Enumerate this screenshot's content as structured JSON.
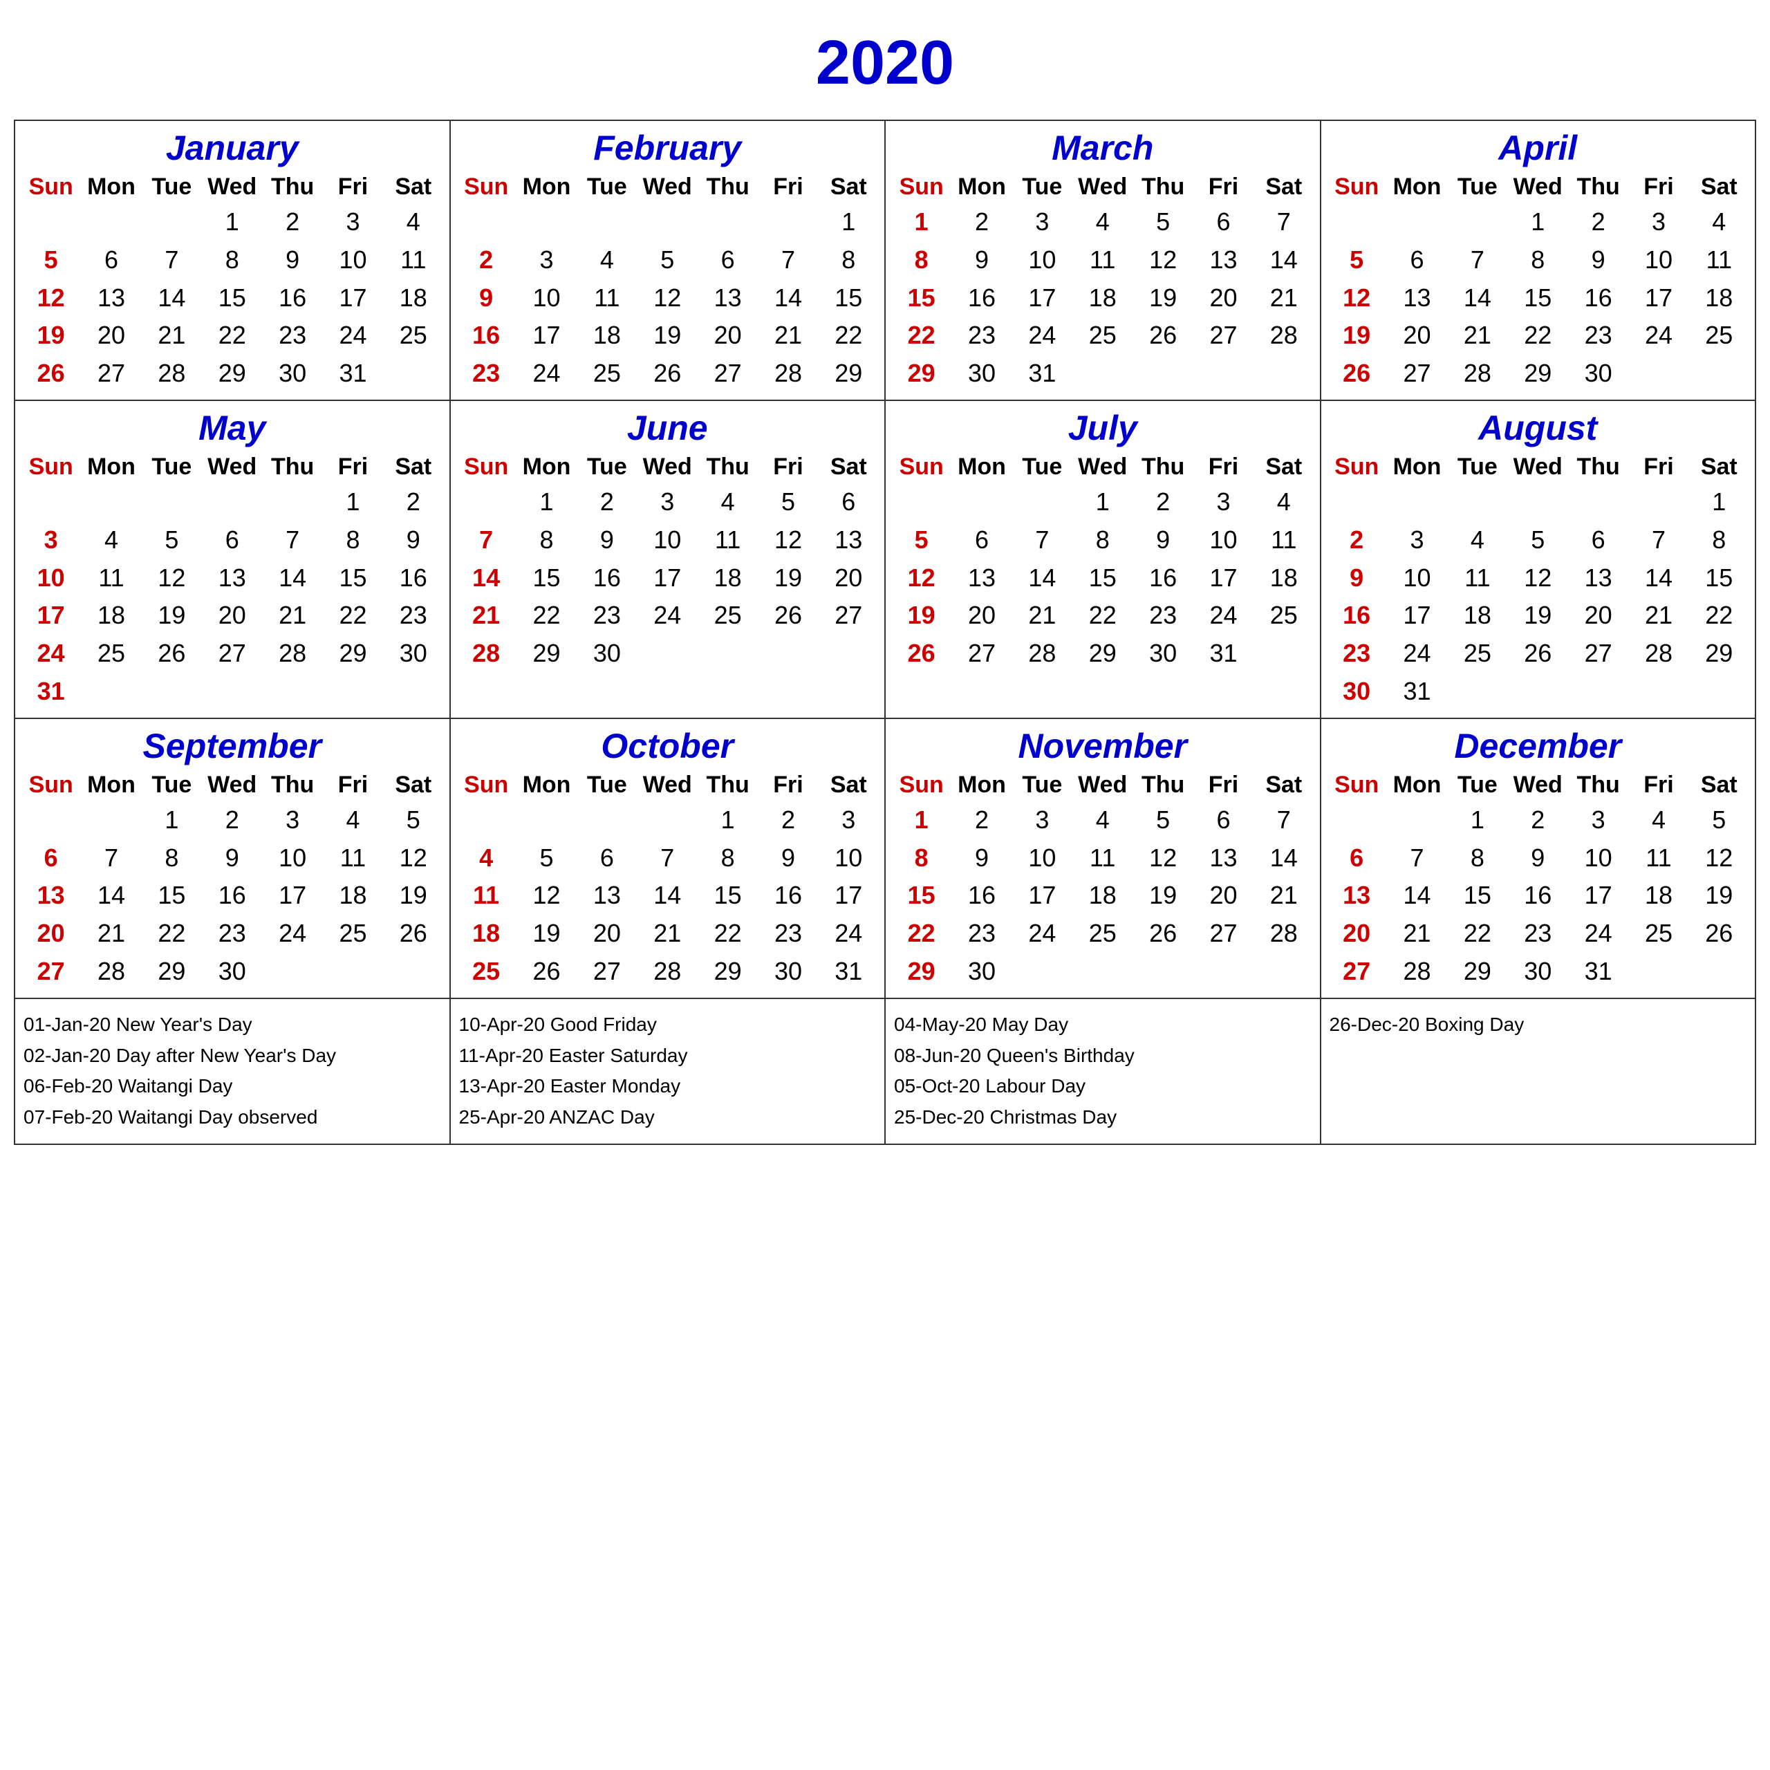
{
  "title": "2020",
  "months": [
    {
      "name": "January",
      "startDay": 3,
      "days": 31,
      "weeks": [
        [
          "",
          "",
          "",
          "1",
          "2",
          "3",
          "4"
        ],
        [
          "5",
          "6",
          "7",
          "8",
          "9",
          "10",
          "11"
        ],
        [
          "12",
          "13",
          "14",
          "15",
          "16",
          "17",
          "18"
        ],
        [
          "19",
          "20",
          "21",
          "22",
          "23",
          "24",
          "25"
        ],
        [
          "26",
          "27",
          "28",
          "29",
          "30",
          "31",
          ""
        ]
      ]
    },
    {
      "name": "February",
      "startDay": 6,
      "days": 29,
      "weeks": [
        [
          "",
          "",
          "",
          "",
          "",
          "",
          "1"
        ],
        [
          "2",
          "3",
          "4",
          "5",
          "6",
          "7",
          "8"
        ],
        [
          "9",
          "10",
          "11",
          "12",
          "13",
          "14",
          "15"
        ],
        [
          "16",
          "17",
          "18",
          "19",
          "20",
          "21",
          "22"
        ],
        [
          "23",
          "24",
          "25",
          "26",
          "27",
          "28",
          "29"
        ]
      ]
    },
    {
      "name": "March",
      "startDay": 0,
      "days": 31,
      "weeks": [
        [
          "1",
          "2",
          "3",
          "4",
          "5",
          "6",
          "7"
        ],
        [
          "8",
          "9",
          "10",
          "11",
          "12",
          "13",
          "14"
        ],
        [
          "15",
          "16",
          "17",
          "18",
          "19",
          "20",
          "21"
        ],
        [
          "22",
          "23",
          "24",
          "25",
          "26",
          "27",
          "28"
        ],
        [
          "29",
          "30",
          "31",
          "",
          "",
          "",
          ""
        ]
      ]
    },
    {
      "name": "April",
      "startDay": 3,
      "days": 30,
      "weeks": [
        [
          "",
          "",
          "",
          "1",
          "2",
          "3",
          "4"
        ],
        [
          "5",
          "6",
          "7",
          "8",
          "9",
          "10",
          "11"
        ],
        [
          "12",
          "13",
          "14",
          "15",
          "16",
          "17",
          "18"
        ],
        [
          "19",
          "20",
          "21",
          "22",
          "23",
          "24",
          "25"
        ],
        [
          "26",
          "27",
          "28",
          "29",
          "30",
          "",
          ""
        ]
      ]
    },
    {
      "name": "May",
      "startDay": 5,
      "days": 31,
      "weeks": [
        [
          "",
          "",
          "",
          "",
          "",
          "1",
          "2"
        ],
        [
          "3",
          "4",
          "5",
          "6",
          "7",
          "8",
          "9"
        ],
        [
          "10",
          "11",
          "12",
          "13",
          "14",
          "15",
          "16"
        ],
        [
          "17",
          "18",
          "19",
          "20",
          "21",
          "22",
          "23"
        ],
        [
          "24",
          "25",
          "26",
          "27",
          "28",
          "29",
          "30"
        ],
        [
          "31",
          "",
          "",
          "",
          "",
          "",
          ""
        ]
      ]
    },
    {
      "name": "June",
      "startDay": 1,
      "days": 30,
      "weeks": [
        [
          "",
          "1",
          "2",
          "3",
          "4",
          "5",
          "6"
        ],
        [
          "7",
          "8",
          "9",
          "10",
          "11",
          "12",
          "13"
        ],
        [
          "14",
          "15",
          "16",
          "17",
          "18",
          "19",
          "20"
        ],
        [
          "21",
          "22",
          "23",
          "24",
          "25",
          "26",
          "27"
        ],
        [
          "28",
          "29",
          "30",
          "",
          "",
          "",
          ""
        ]
      ]
    },
    {
      "name": "July",
      "startDay": 3,
      "days": 31,
      "weeks": [
        [
          "",
          "",
          "",
          "1",
          "2",
          "3",
          "4"
        ],
        [
          "5",
          "6",
          "7",
          "8",
          "9",
          "10",
          "11"
        ],
        [
          "12",
          "13",
          "14",
          "15",
          "16",
          "17",
          "18"
        ],
        [
          "19",
          "20",
          "21",
          "22",
          "23",
          "24",
          "25"
        ],
        [
          "26",
          "27",
          "28",
          "29",
          "30",
          "31",
          ""
        ]
      ]
    },
    {
      "name": "August",
      "startDay": 6,
      "days": 31,
      "weeks": [
        [
          "",
          "",
          "",
          "",
          "",
          "",
          "1"
        ],
        [
          "2",
          "3",
          "4",
          "5",
          "6",
          "7",
          "8"
        ],
        [
          "9",
          "10",
          "11",
          "12",
          "13",
          "14",
          "15"
        ],
        [
          "16",
          "17",
          "18",
          "19",
          "20",
          "21",
          "22"
        ],
        [
          "23",
          "24",
          "25",
          "26",
          "27",
          "28",
          "29"
        ],
        [
          "30",
          "31",
          "",
          "",
          "",
          "",
          ""
        ]
      ]
    },
    {
      "name": "September",
      "startDay": 2,
      "days": 30,
      "weeks": [
        [
          "",
          "",
          "1",
          "2",
          "3",
          "4",
          "5"
        ],
        [
          "6",
          "7",
          "8",
          "9",
          "10",
          "11",
          "12"
        ],
        [
          "13",
          "14",
          "15",
          "16",
          "17",
          "18",
          "19"
        ],
        [
          "20",
          "21",
          "22",
          "23",
          "24",
          "25",
          "26"
        ],
        [
          "27",
          "28",
          "29",
          "30",
          "",
          "",
          ""
        ]
      ]
    },
    {
      "name": "October",
      "startDay": 4,
      "days": 31,
      "weeks": [
        [
          "",
          "",
          "",
          "",
          "1",
          "2",
          "3"
        ],
        [
          "4",
          "5",
          "6",
          "7",
          "8",
          "9",
          "10"
        ],
        [
          "11",
          "12",
          "13",
          "14",
          "15",
          "16",
          "17"
        ],
        [
          "18",
          "19",
          "20",
          "21",
          "22",
          "23",
          "24"
        ],
        [
          "25",
          "26",
          "27",
          "28",
          "29",
          "30",
          "31"
        ]
      ]
    },
    {
      "name": "November",
      "startDay": 0,
      "days": 30,
      "weeks": [
        [
          "1",
          "2",
          "3",
          "4",
          "5",
          "6",
          "7"
        ],
        [
          "8",
          "9",
          "10",
          "11",
          "12",
          "13",
          "14"
        ],
        [
          "15",
          "16",
          "17",
          "18",
          "19",
          "20",
          "21"
        ],
        [
          "22",
          "23",
          "24",
          "25",
          "26",
          "27",
          "28"
        ],
        [
          "29",
          "30",
          "",
          "",
          "",
          "",
          ""
        ]
      ]
    },
    {
      "name": "December",
      "startDay": 2,
      "days": 31,
      "weeks": [
        [
          "",
          "",
          "1",
          "2",
          "3",
          "4",
          "5"
        ],
        [
          "6",
          "7",
          "8",
          "9",
          "10",
          "11",
          "12"
        ],
        [
          "13",
          "14",
          "15",
          "16",
          "17",
          "18",
          "19"
        ],
        [
          "20",
          "21",
          "22",
          "23",
          "24",
          "25",
          "26"
        ],
        [
          "27",
          "28",
          "29",
          "30",
          "31",
          "",
          ""
        ]
      ]
    }
  ],
  "dayHeaders": [
    "Sun",
    "Mon",
    "Tue",
    "Wed",
    "Thu",
    "Fri",
    "Sat"
  ],
  "holidays": [
    {
      "col": 0,
      "entries": [
        "01-Jan-20 New Year's Day",
        "02-Jan-20 Day after New Year's Day",
        "06-Feb-20 Waitangi Day",
        "07-Feb-20 Waitangi Day observed"
      ]
    },
    {
      "col": 1,
      "entries": [
        "10-Apr-20 Good Friday",
        "11-Apr-20 Easter Saturday",
        "13-Apr-20 Easter Monday",
        "25-Apr-20 ANZAC Day"
      ]
    },
    {
      "col": 2,
      "entries": [
        "04-May-20 May Day",
        "08-Jun-20 Queen's Birthday",
        "05-Oct-20 Labour Day",
        "25-Dec-20 Christmas Day"
      ]
    },
    {
      "col": 3,
      "entries": [
        "26-Dec-20 Boxing Day"
      ]
    }
  ]
}
